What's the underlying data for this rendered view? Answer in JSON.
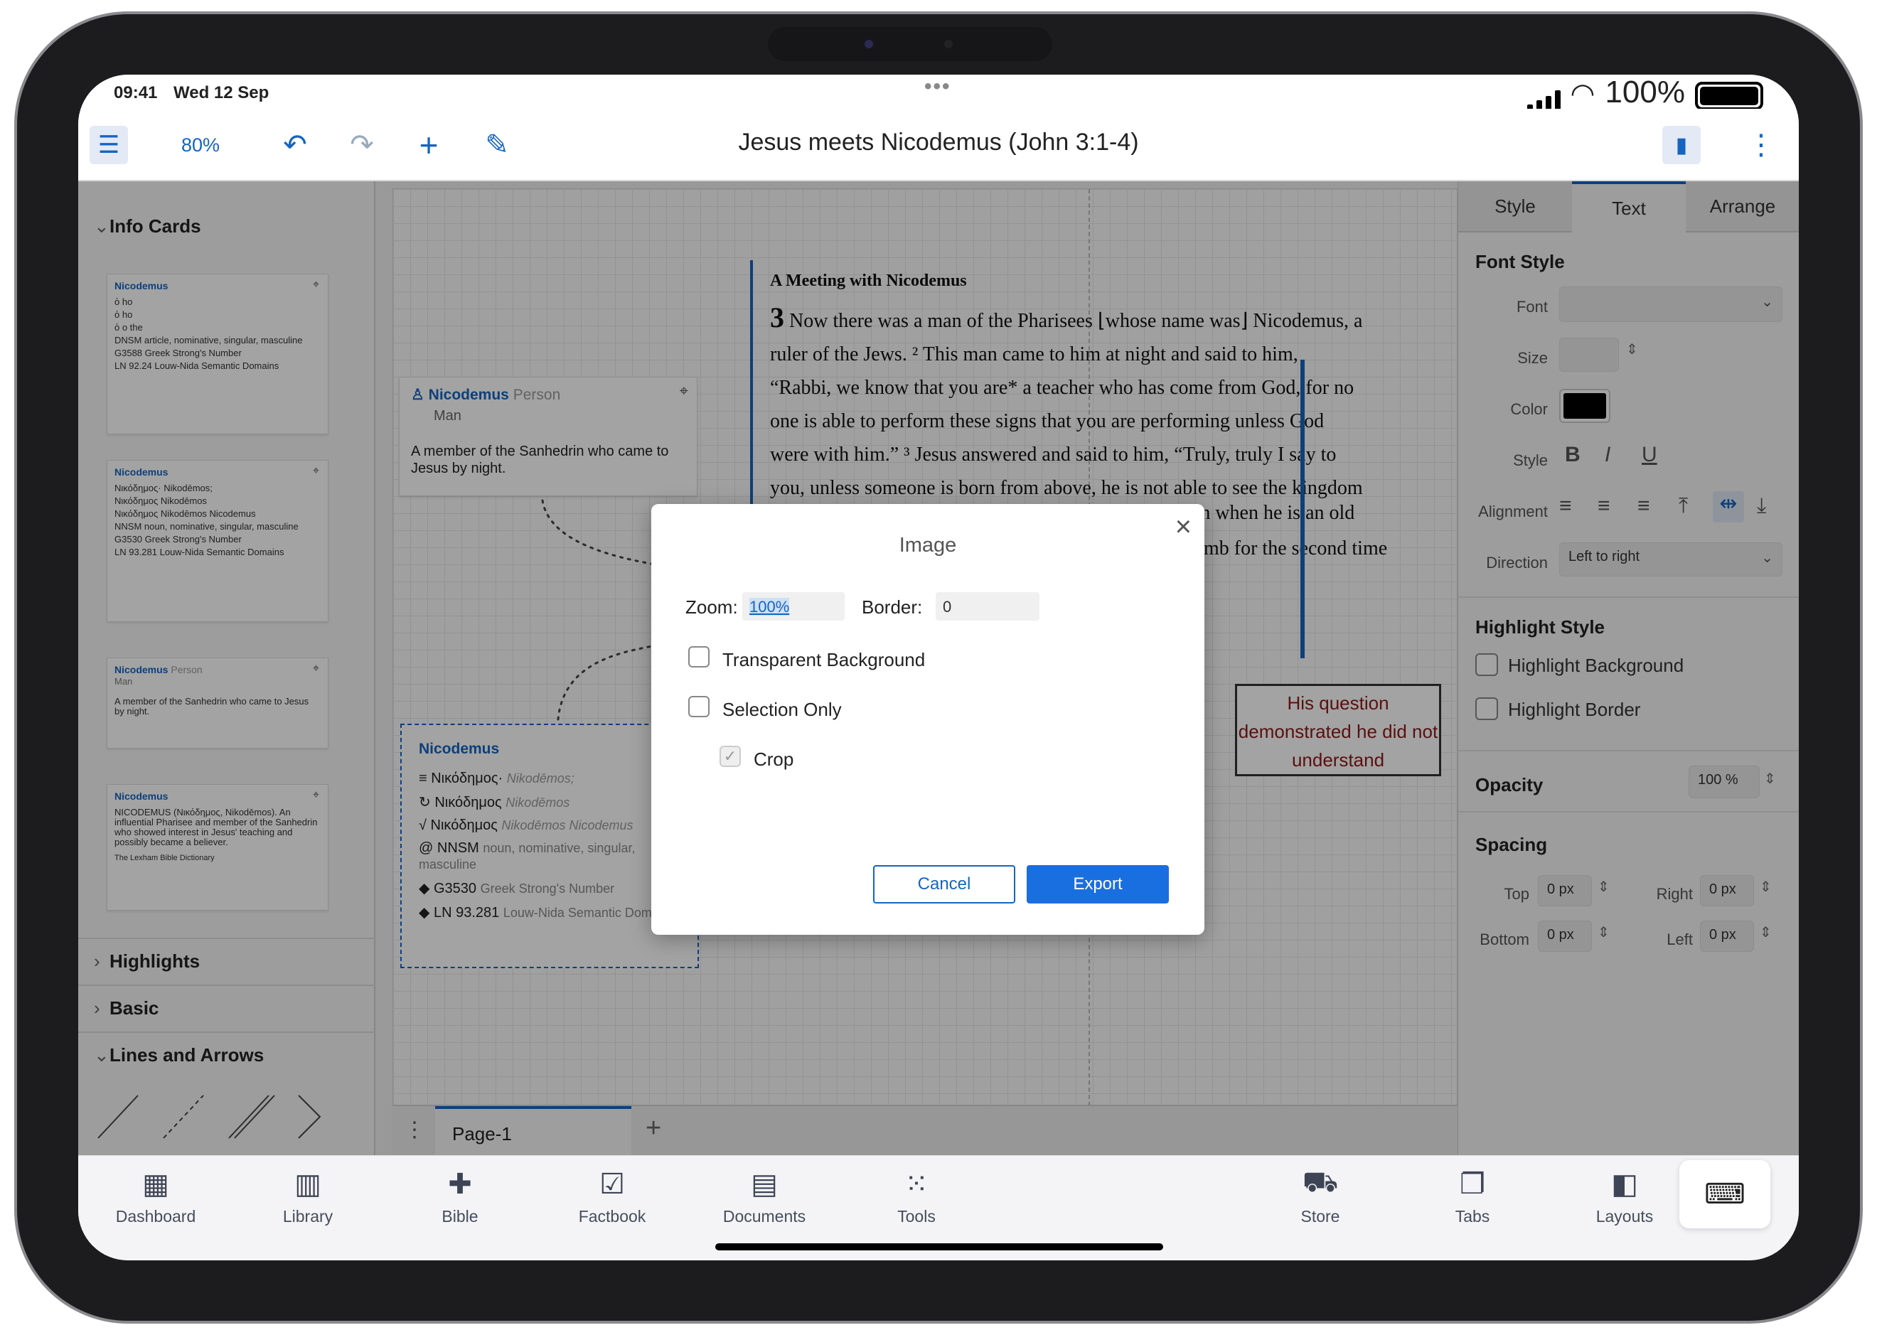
{
  "status": {
    "time": "09:41",
    "date": "Wed 12 Sep",
    "dots": "•••",
    "battery": "100%"
  },
  "toolbar": {
    "zoom": "80%",
    "title": "Jesus meets Nicodemus (John 3:1-4)"
  },
  "left": {
    "info_cards": "Info Cards",
    "highlights": "Highlights",
    "basic": "Basic",
    "lines": "Lines and Arrows",
    "card1": {
      "title": "Nicodemus",
      "rows": [
        "ὁ ho",
        "ὁ ho",
        "ὁ o the",
        "DNSM article, nominative, singular, masculine",
        "G3588 Greek Strong's Number",
        "LN 92.24 Louw-Nida Semantic Domains"
      ]
    },
    "card2": {
      "title": "Nicodemus",
      "rows": [
        "Νικόδημος· Nikodēmos;",
        "Νικόδημος Nikodēmos",
        "Νικόδημος Nikodēmos Nicodemus",
        "NNSM noun, nominative, singular, masculine",
        "G3530 Greek Strong's Number",
        "LN 93.281 Louw-Nida Semantic Domains"
      ]
    },
    "card3": {
      "title": "Nicodemus",
      "type": "Person",
      "sub": "Man",
      "desc": "A member of the Sanhedrin who came to Jesus by night."
    },
    "card4": {
      "title": "Nicodemus",
      "desc": "NICODEMUS (Νικόδημος, Nikodēmos). An influential Pharisee and member of the Sanhedrin who showed interest in Jesus' teaching and possibly became a believer.",
      "source": "The Lexham Bible Dictionary"
    }
  },
  "canvas": {
    "person_card": {
      "title": "Nicodemus",
      "type": "Person",
      "sub": "Man",
      "desc": "A member of the Sanhedrin who came to Jesus by night."
    },
    "word_card": {
      "title": "Nicodemus",
      "rows": [
        {
          "g": "Νικόδημος·",
          "t": "Nikodēmos;"
        },
        {
          "g": "Νικόδημος",
          "t": "Nikodēmos"
        },
        {
          "g": "Νικόδημος",
          "t": "Nikodēmos Nicodemus"
        },
        {
          "g": "NNSM",
          "t": "noun, nominative, singular, masculine"
        },
        {
          "g": "G3530",
          "t": "Greek Strong's Number"
        },
        {
          "g": "LN 93.281",
          "t": "Louw-Nida Semantic Domains"
        }
      ]
    },
    "passage": {
      "heading": "A Meeting with Nicodemus",
      "lines": [
        "Now there was a man of the Pharisees ⌊whose name was⌋ Nicodemus, a",
        "ruler of the Jews. ² This man came to him at night and said to him,",
        "“Rabbi, we know that you are* a teacher who has come from God, for no",
        "one is able to perform these signs that you are performing unless God",
        "were with him.” ³ Jesus answered and said to him, “Truly, truly I say to",
        "you, unless someone is born from above, he is not able to see the kingdom"
      ],
      "verse": "3",
      "frag1": "rn when he is an old",
      "frag2": "omb for the second time"
    },
    "callout": "His question demonstrated he did not understand",
    "page_tab": "Page-1"
  },
  "right": {
    "tabs": [
      "Style",
      "Text",
      "Arrange"
    ],
    "font_style": "Font Style",
    "font": "Font",
    "size": "Size",
    "color": "Color",
    "style": "Style",
    "alignment": "Alignment",
    "direction": "Direction",
    "direction_value": "Left to right",
    "highlight_style": "Highlight Style",
    "hl_bg": "Highlight Background",
    "hl_border": "Highlight Border",
    "opacity": "Opacity",
    "opacity_value": "100 %",
    "spacing": "Spacing",
    "top": "Top",
    "right": "Right",
    "bottom": "Bottom",
    "left": "Left",
    "px": "0 px"
  },
  "dock": [
    "Dashboard",
    "Library",
    "Bible",
    "Factbook",
    "Documents",
    "Tools",
    "Store",
    "Tabs",
    "Layouts"
  ],
  "dialog": {
    "title": "Image",
    "zoom_label": "Zoom:",
    "zoom_value": "100%",
    "border_label": "Border:",
    "border_value": "0",
    "transparent": "Transparent Background",
    "selection": "Selection Only",
    "crop": "Crop",
    "cancel": "Cancel",
    "export": "Export"
  }
}
